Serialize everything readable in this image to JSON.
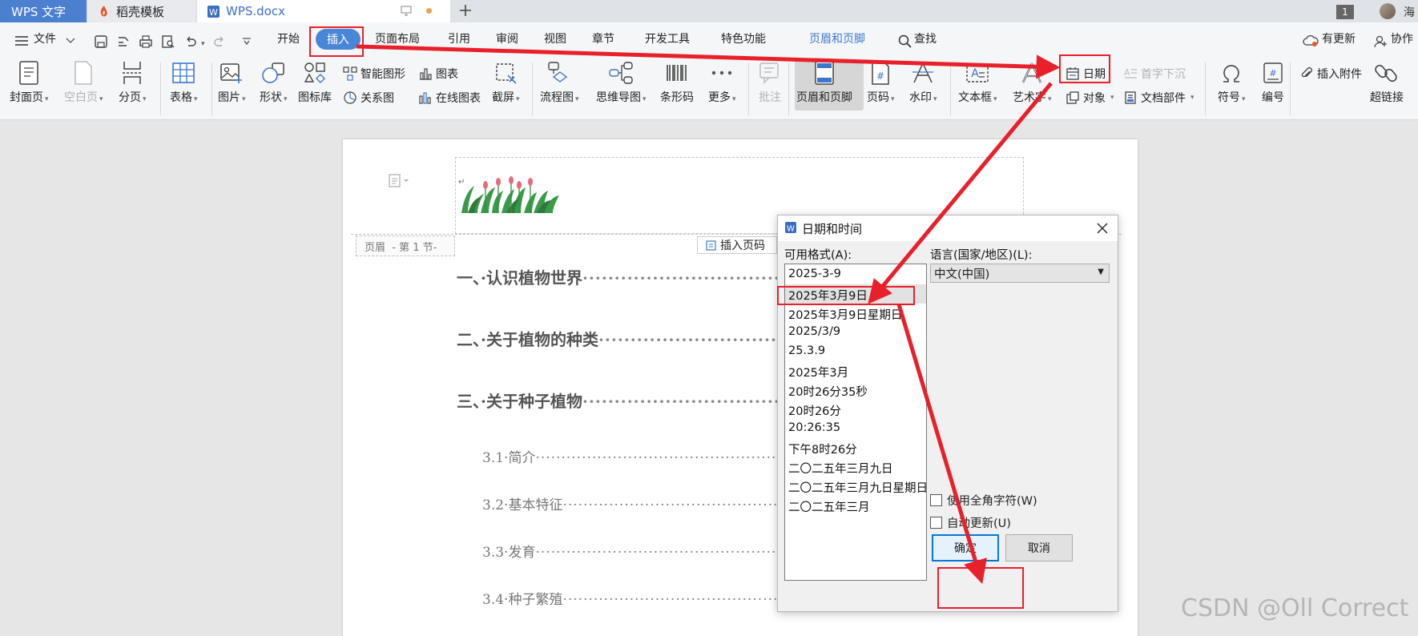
{
  "tabs": [
    {
      "label": "WPS 文字"
    },
    {
      "label": "稻壳模板"
    },
    {
      "label": "WPS.docx"
    }
  ],
  "window": {
    "page_badge": "1",
    "user_name": "海"
  },
  "menu": {
    "file": "文件",
    "items": [
      "开始",
      "插入",
      "页面布局",
      "引用",
      "审阅",
      "视图",
      "章节",
      "开发工具",
      "特色功能",
      "页眉和页脚"
    ],
    "search": "查找",
    "update": "有更新",
    "collab": "协作"
  },
  "ribbon": {
    "cover": "封面页",
    "blank": "空白页",
    "pagebreak": "分页",
    "table": "表格",
    "picture": "图片",
    "shape": "形状",
    "iconlib": "图标库",
    "smartshape": "智能图形",
    "relation": "关系图",
    "chart": "图表",
    "onlinechart": "在线图表",
    "screenshot": "截屏",
    "flowchart": "流程图",
    "mindmap": "思维导图",
    "barcode": "条形码",
    "more": "更多",
    "comment": "批注",
    "headerfooter": "页眉和页脚",
    "pagenum": "页码",
    "watermark": "水印",
    "textbox": "文本框",
    "wordart": "艺术字",
    "date": "日期",
    "dropcap": "首字下沉",
    "object": "对象",
    "docparts": "文档部件",
    "symbol": "符号",
    "numbering": "编号",
    "attach": "插入附件",
    "hyperlink": "超链接"
  },
  "document": {
    "header_label": "页眉  - 第 1 节-",
    "insert_pagenum": "插入页码",
    "toc": [
      {
        "text": "一、·认识植物世界"
      },
      {
        "text": "二、·关于植物的种类"
      },
      {
        "text": "三、·关于种子植物"
      },
      {
        "text": "3.1·简介"
      },
      {
        "text": "3.2·基本特征"
      },
      {
        "text": "3.3·发育"
      },
      {
        "text": "3.4·种子繁殖"
      }
    ]
  },
  "dialog": {
    "title": "日期和时间",
    "formats_label": "可用格式(A):",
    "formats": [
      "2025-3-9",
      "2025年3月9日",
      "2025年3月9日星期日",
      "2025/3/9",
      "25.3.9",
      "2025年3月",
      "20时26分35秒",
      "20时26分",
      "20:26:35",
      "下午8时26分",
      "二〇二五年三月九日",
      "二〇二五年三月九日星期日",
      "二〇二五年三月"
    ],
    "selected_index": 1,
    "language_label": "语言(国家/地区)(L):",
    "language_value": "中文(中国)",
    "fullwidth_label": "使用全角字符(W)",
    "autoupdate_label": "自动更新(U)",
    "ok": "确定",
    "cancel": "取消"
  },
  "watermark": "CSDN @Oll Correct",
  "colors": {
    "accent": "#4a86d8",
    "annotation": "#e8202a"
  }
}
